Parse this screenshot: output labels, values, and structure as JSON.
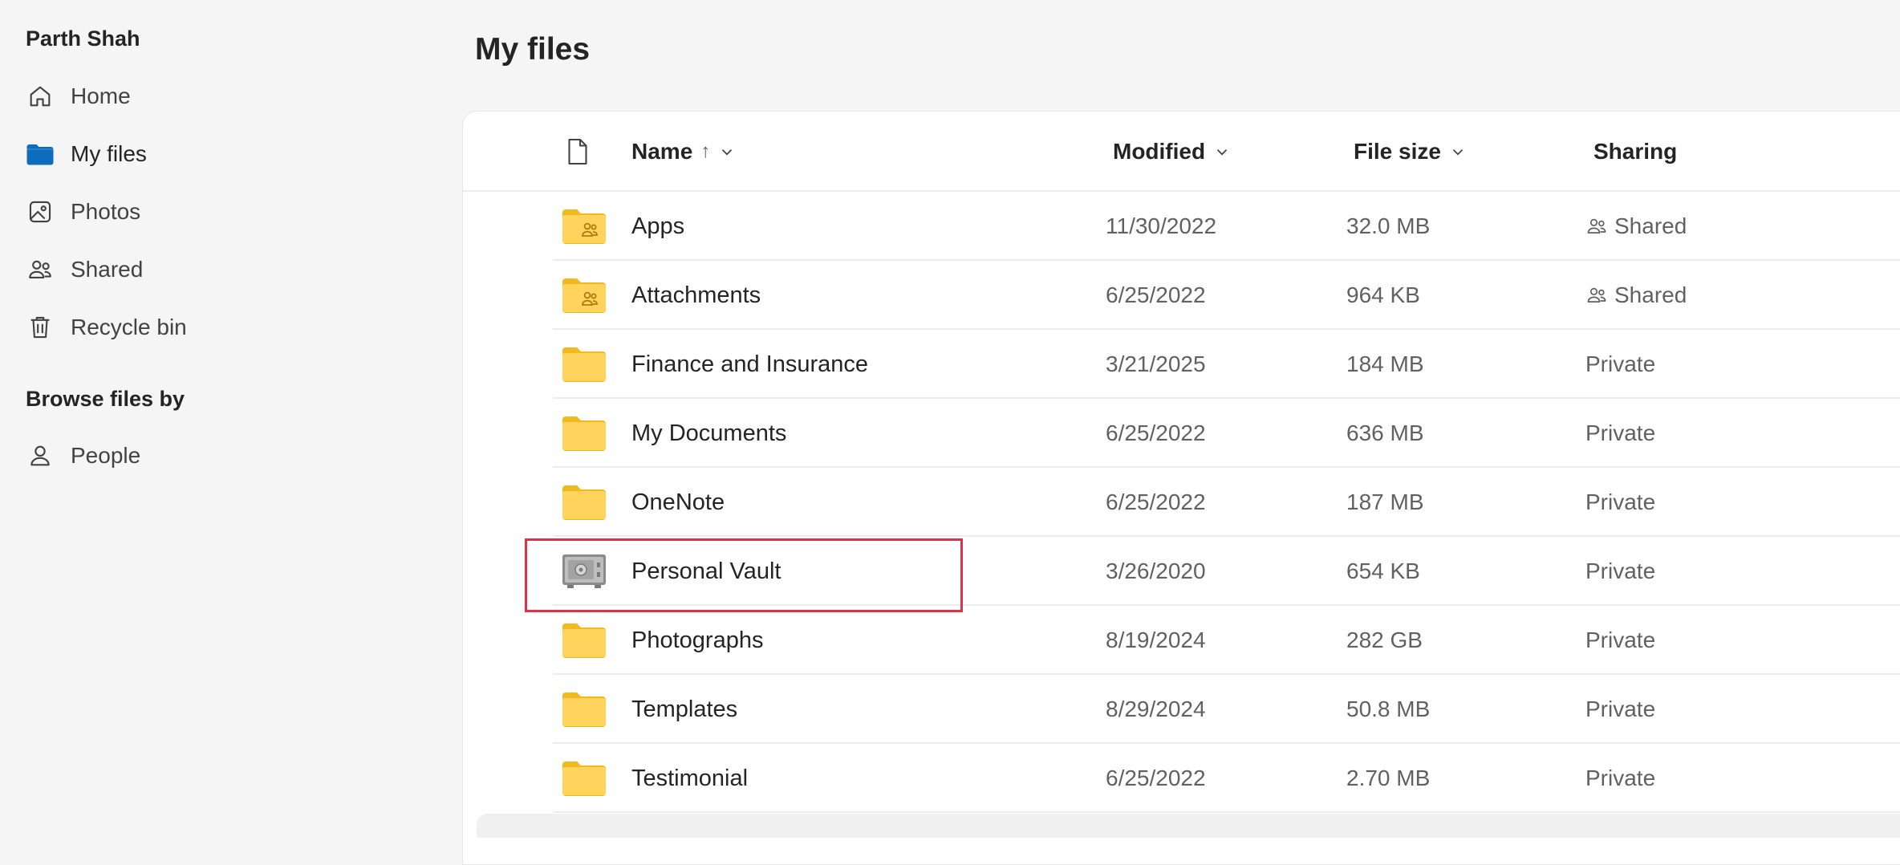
{
  "user": {
    "name": "Parth Shah"
  },
  "sidebar": {
    "items": [
      {
        "label": "Home",
        "icon": "home-icon"
      },
      {
        "label": "My files",
        "icon": "folder-icon",
        "active": true
      },
      {
        "label": "Photos",
        "icon": "photo-icon"
      },
      {
        "label": "Shared",
        "icon": "people-icon"
      },
      {
        "label": "Recycle bin",
        "icon": "trash-icon"
      }
    ],
    "browse_label": "Browse files by",
    "browse_items": [
      {
        "label": "People",
        "icon": "person-icon"
      }
    ]
  },
  "page": {
    "title": "My files"
  },
  "table": {
    "columns": {
      "type_icon": "file-icon",
      "name": "Name",
      "name_sort": "↑",
      "modified": "Modified",
      "file_size": "File size",
      "sharing": "Sharing"
    },
    "rows": [
      {
        "name": "Apps",
        "modified": "11/30/2022",
        "size": "32.0 MB",
        "sharing": "Shared",
        "icon": "shared-folder-icon"
      },
      {
        "name": "Attachments",
        "modified": "6/25/2022",
        "size": "964 KB",
        "sharing": "Shared",
        "icon": "shared-folder-icon"
      },
      {
        "name": "Finance and Insurance",
        "modified": "3/21/2025",
        "size": "184 MB",
        "sharing": "Private",
        "icon": "folder-icon"
      },
      {
        "name": "My Documents",
        "modified": "6/25/2022",
        "size": "636 MB",
        "sharing": "Private",
        "icon": "folder-icon"
      },
      {
        "name": "OneNote",
        "modified": "6/25/2022",
        "size": "187 MB",
        "sharing": "Private",
        "icon": "folder-icon"
      },
      {
        "name": "Personal Vault",
        "modified": "3/26/2020",
        "size": "654 KB",
        "sharing": "Private",
        "icon": "vault-icon"
      },
      {
        "name": "Photographs",
        "modified": "8/19/2024",
        "size": "282 GB",
        "sharing": "Private",
        "icon": "folder-icon"
      },
      {
        "name": "Templates",
        "modified": "8/29/2024",
        "size": "50.8 MB",
        "sharing": "Private",
        "icon": "folder-icon"
      },
      {
        "name": "Testimonial",
        "modified": "6/25/2022",
        "size": "2.70 MB",
        "sharing": "Private",
        "icon": "folder-icon"
      }
    ]
  },
  "colors": {
    "accent": "#0f6cbd",
    "folder": "#ffd35c",
    "folder_tab": "#f2b91d",
    "highlight": "#d9344a"
  }
}
